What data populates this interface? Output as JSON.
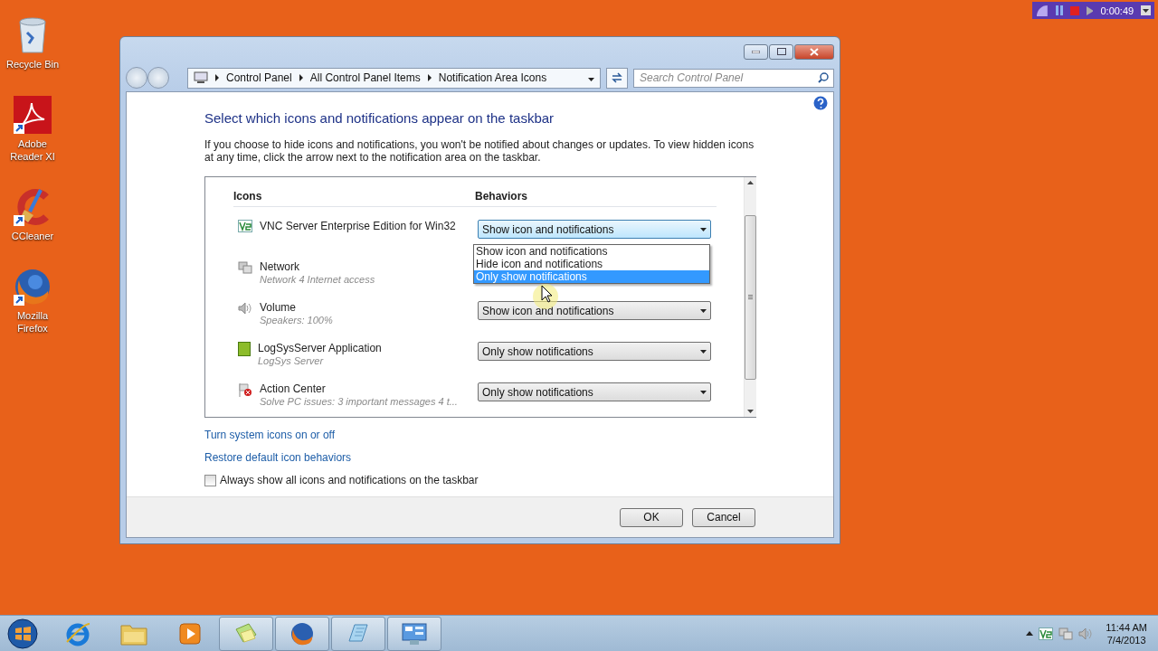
{
  "desktop_icons": [
    {
      "label": "Recycle Bin",
      "kind": "recycle"
    },
    {
      "label": "Adobe Reader XI",
      "kind": "reader"
    },
    {
      "label": "CCleaner",
      "kind": "cleaner"
    },
    {
      "label": "Mozilla Firefox",
      "kind": "firefox"
    }
  ],
  "recorder": {
    "time": "0:00:49"
  },
  "window": {
    "breadcrumb": [
      "Control Panel",
      "All Control Panel Items",
      "Notification Area Icons"
    ],
    "search": {
      "placeholder": "Search Control Panel"
    },
    "heading": "Select which icons and notifications appear on the taskbar",
    "description": "If you choose to hide icons and notifications, you won't be notified about changes or updates. To view hidden icons at any time, click the arrow next to the notification area on the taskbar.",
    "columns": [
      "Icons",
      "Behaviors"
    ],
    "rows": [
      {
        "kind": "vnc",
        "name": "VNC Server Enterprise Edition for Win32",
        "behavior": "Show icon and notifications",
        "options": [
          {
            "label": "Show icon and notifications",
            "selected": false
          },
          {
            "label": "Hide icon and notifications",
            "selected": false
          },
          {
            "label": "Only show notifications",
            "selected": true
          }
        ]
      },
      {
        "kind": "network",
        "name": "Network",
        "detail": "Network  4 Internet access"
      },
      {
        "kind": "volume",
        "name": "Volume",
        "detail": "Speakers: 100%",
        "behavior": "Show icon and notifications"
      },
      {
        "kind": "app",
        "name": "LogSysServer Application",
        "detail": "LogSys Server",
        "behavior": "Only show notifications"
      },
      {
        "kind": "flag",
        "name": "Action Center",
        "detail": "Solve PC issues: 3 important messages  4 t...",
        "behavior": "Only show notifications"
      }
    ],
    "links": [
      "Turn system icons on or off",
      "Restore default icon behaviors"
    ],
    "checkbox": {
      "label": "Always show all icons and notifications on the taskbar",
      "checked": false
    },
    "buttons": [
      "OK",
      "Cancel"
    ]
  },
  "taskbar": {
    "apps": [
      {
        "kind": "ie",
        "running": false
      },
      {
        "kind": "folder",
        "running": false
      },
      {
        "kind": "media",
        "running": false
      },
      {
        "kind": "notes",
        "running": true
      },
      {
        "kind": "firefox",
        "running": true
      },
      {
        "kind": "notepad",
        "running": true
      },
      {
        "kind": "panel",
        "running": true
      }
    ],
    "clock": {
      "time": "11:44 AM",
      "date": "7/4/2013"
    }
  }
}
